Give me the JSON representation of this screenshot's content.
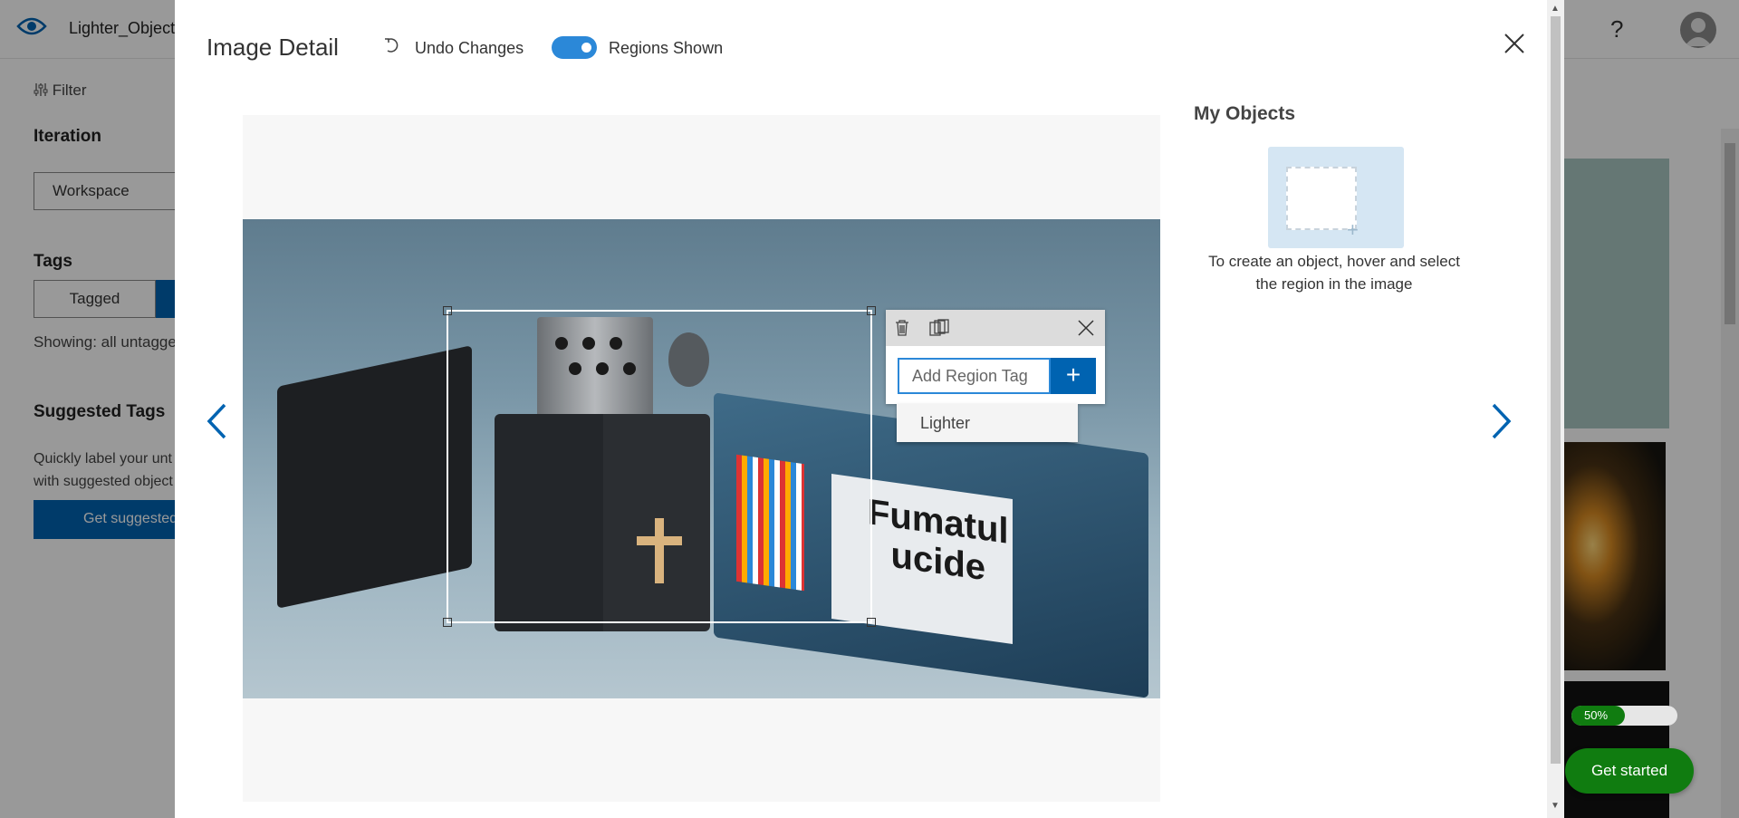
{
  "app": {
    "project_name": "Lighter_Object",
    "help_label": "?"
  },
  "left": {
    "filter_label": "Filter",
    "iteration_title": "Iteration",
    "iteration_value": "Workspace",
    "tags_title": "Tags",
    "tagged_label": "Tagged",
    "showing_text": "Showing: all untagged",
    "suggested_title": "Suggested Tags",
    "suggested_desc_line1": "Quickly label your unt",
    "suggested_desc_line2": "with suggested object",
    "suggested_button": "Get suggested"
  },
  "right": {
    "progress_label": "50%",
    "progress_value": 0.5,
    "get_started": "Get started"
  },
  "modal": {
    "title": "Image Detail",
    "undo_label": "Undo Changes",
    "regions_label": "Regions Shown",
    "regions_shown": true,
    "image_text_line1": "Fumatul",
    "image_text_line2": "ucide",
    "region_popup": {
      "input_placeholder": "Add Region Tag",
      "add_button": "+",
      "suggestions": [
        "Lighter"
      ]
    },
    "my_objects": {
      "title": "My Objects",
      "plus": "+",
      "hint": "To create an object, hover and select the region in the image"
    }
  },
  "colors": {
    "accent": "#0063b1",
    "toggle_on": "#2b88d8",
    "success": "#107c10"
  },
  "icons": [
    "eye-icon",
    "filter-icon",
    "help-icon",
    "avatar-icon",
    "undo-icon",
    "close-icon",
    "trash-icon",
    "multiple-regions-icon",
    "chevron-left-icon",
    "chevron-right-icon"
  ]
}
